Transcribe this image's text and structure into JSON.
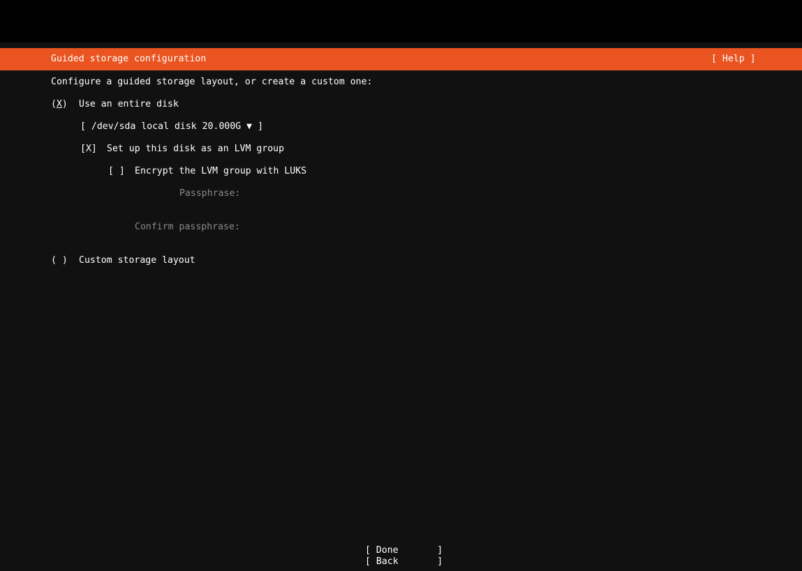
{
  "header": {
    "title": "Guided storage configuration",
    "help_label": "[ Help ]"
  },
  "intro": "Configure a guided storage layout, or create a custom one:",
  "entire_disk": {
    "radio_open": "(",
    "radio_mark": "X",
    "radio_close": ")",
    "label": "Use an entire disk",
    "disk_select": "[ /dev/sda local disk 20.000G ▼ ]",
    "lvm_checkbox": "[X]",
    "lvm_label": "Set up this disk as an LVM group",
    "encrypt_checkbox": "[ ]",
    "encrypt_label": "Encrypt the LVM group with LUKS",
    "passphrase_label": "Passphrase:",
    "passphrase_value": "",
    "confirm_label": "Confirm passphrase:",
    "confirm_value": ""
  },
  "custom_layout": {
    "radio": "( )",
    "label": "Custom storage layout"
  },
  "buttons": {
    "done": "[ Done       ]",
    "back": "[ Back       ]"
  },
  "colors": {
    "accent": "#e95420",
    "background": "#111111",
    "topbar": "#000000",
    "dim_text": "#8a8a8a"
  }
}
